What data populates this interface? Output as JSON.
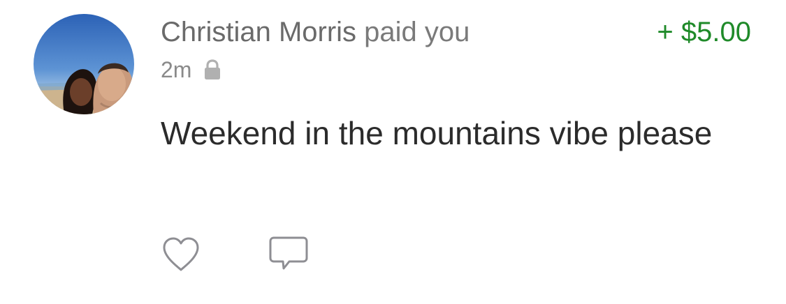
{
  "payment": {
    "sender_name": "Christian Morris",
    "action_text": "paid you",
    "amount": "+ $5.00",
    "time": "2m",
    "privacy_icon": "lock-icon",
    "message": "Weekend in the mountains vibe please"
  },
  "actions": {
    "like_icon": "heart-icon",
    "comment_icon": "comment-icon"
  },
  "colors": {
    "amount_positive": "#1f8a29",
    "secondary_text": "#8a8a8a",
    "body_text": "#2b2b2b",
    "icon_gray": "#8e8e93"
  }
}
